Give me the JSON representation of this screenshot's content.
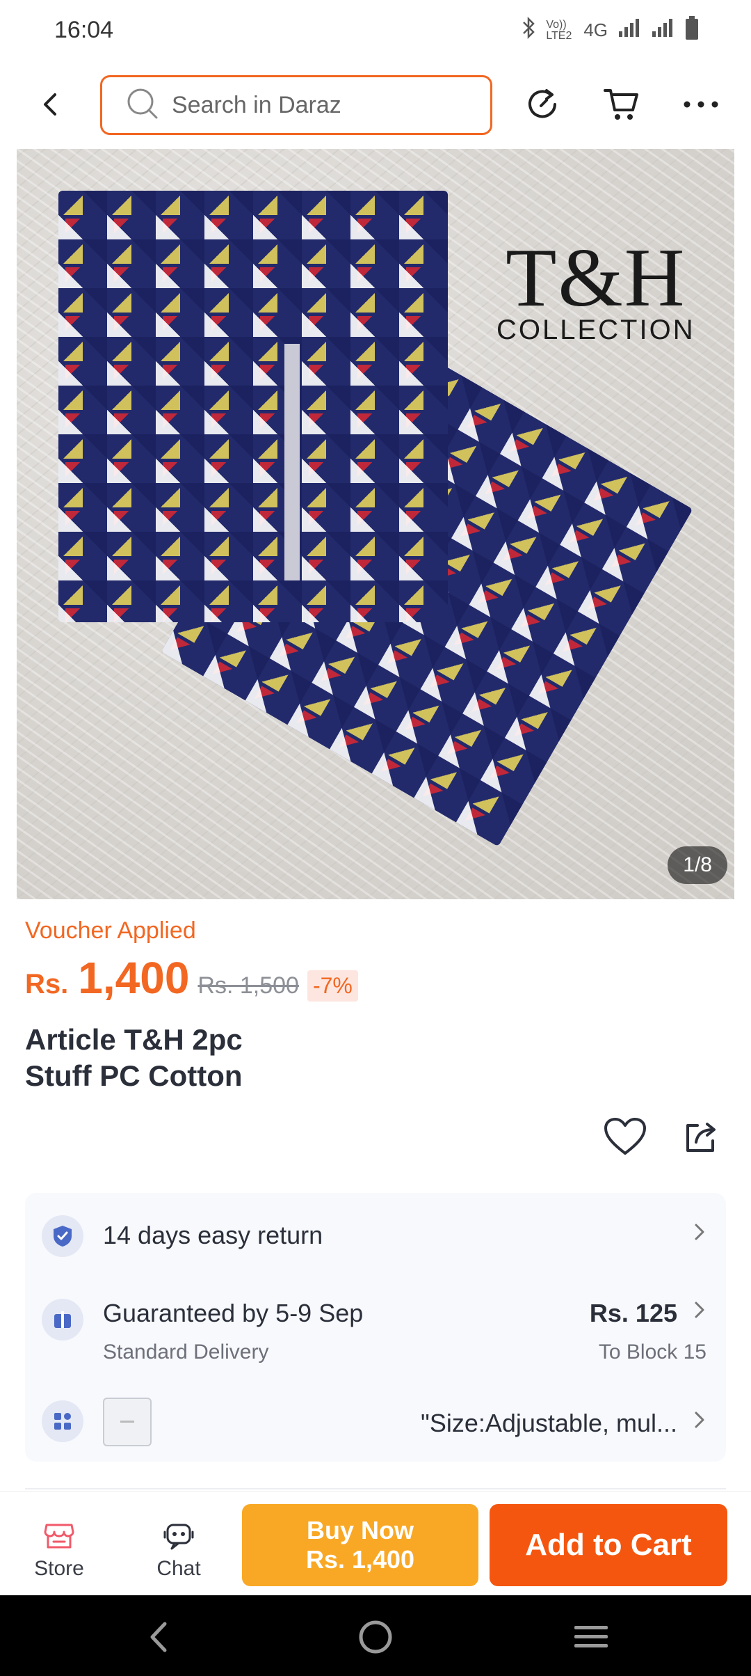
{
  "status_bar": {
    "time": "16:04",
    "icons": [
      "bluetooth-icon",
      "volte-icon",
      "4g-icon",
      "signal-icon",
      "signal-icon",
      "battery-icon"
    ],
    "volte_label": "Vo)) LTE2",
    "network_label": "4G"
  },
  "top_nav": {
    "search_placeholder": "Search in Daraz"
  },
  "product_image": {
    "brand_name": "T&H",
    "brand_sub": "COLLECTION",
    "counter": "1/8"
  },
  "pricing": {
    "voucher_label": "Voucher Applied",
    "currency": "Rs.",
    "price": "1,400",
    "old_price": "Rs. 1,500",
    "discount": "-7%"
  },
  "product": {
    "title_line1": "Article T&H 2pc",
    "title_line2": "Stuff PC Cotton"
  },
  "info": {
    "return_text": "14 days easy return",
    "delivery_text": "Guaranteed by 5-9 Sep",
    "delivery_sub": "Standard Delivery",
    "delivery_price": "Rs. 125",
    "delivery_location": "To Block 15",
    "variant_text": "\"Size:Adjustable, mul..."
  },
  "bottom_bar": {
    "store_label": "Store",
    "chat_label": "Chat",
    "buy_now_label": "Buy Now",
    "buy_now_price": "Rs. 1,400",
    "add_to_cart_label": "Add to Cart"
  },
  "colors": {
    "accent": "#f26722",
    "buy_now": "#f9a825",
    "add_to_cart": "#f5560f"
  }
}
